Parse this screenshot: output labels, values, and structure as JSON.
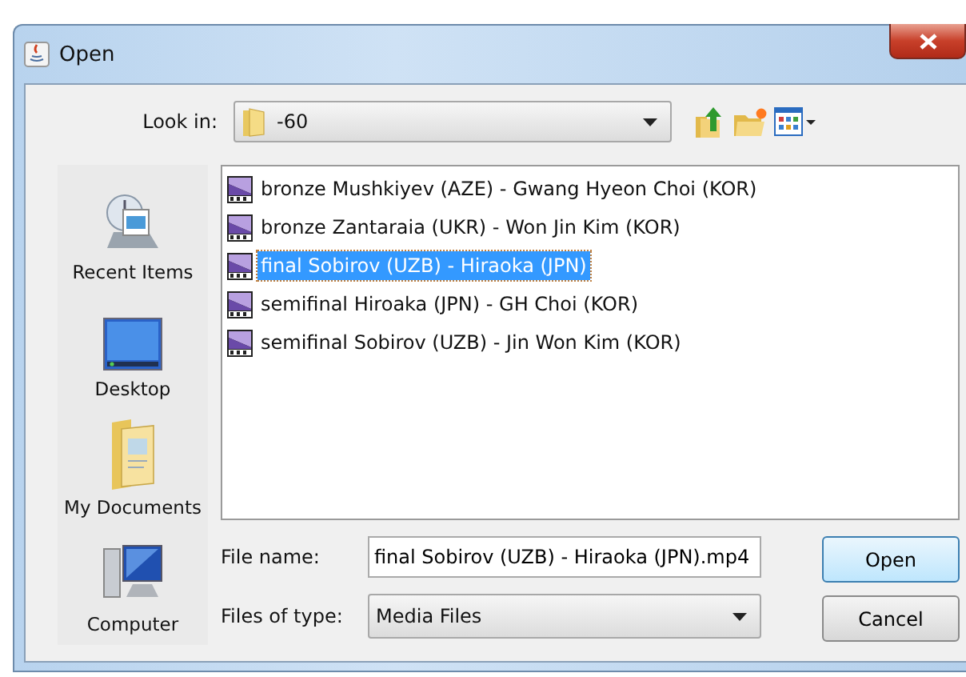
{
  "window": {
    "title": "Open"
  },
  "look_in": {
    "label": "Look in:",
    "value": "-60"
  },
  "places": [
    {
      "kind": "recent",
      "label": "Recent Items"
    },
    {
      "kind": "desktop",
      "label": "Desktop"
    },
    {
      "kind": "documents",
      "label": "My Documents"
    },
    {
      "kind": "computer",
      "label": "Computer"
    }
  ],
  "files": [
    {
      "name": "bronze Mushkiyev (AZE) - Gwang Hyeon Choi (KOR)",
      "selected": false
    },
    {
      "name": "bronze Zantaraia (UKR) - Won Jin Kim (KOR)",
      "selected": false
    },
    {
      "name": "final Sobirov (UZB) - Hiraoka (JPN)",
      "selected": true
    },
    {
      "name": "semifinal Hiroaka (JPN) - GH Choi (KOR)",
      "selected": false
    },
    {
      "name": "semifinal Sobirov (UZB) - Jin Won Kim (KOR)",
      "selected": false
    }
  ],
  "file_name": {
    "label": "File name:",
    "value": "final Sobirov (UZB) - Hiraoka (JPN).mp4"
  },
  "file_type": {
    "label": "Files of type:",
    "value": "Media Files"
  },
  "buttons": [
    "Open",
    "Cancel"
  ]
}
